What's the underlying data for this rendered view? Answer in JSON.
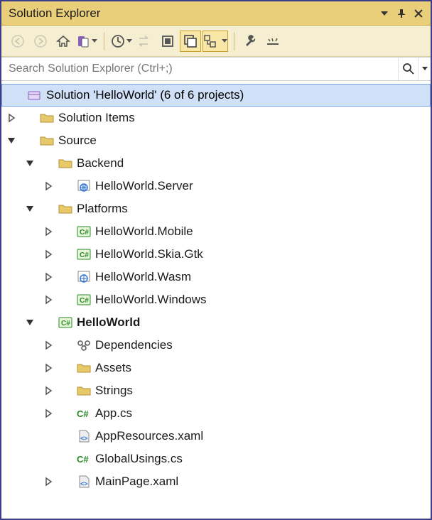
{
  "window": {
    "title": "Solution Explorer"
  },
  "toolbar": {
    "back": "Back",
    "forward": "Forward",
    "home": "Home",
    "switch_views": "Switch Views",
    "pending_filter": "Filter",
    "sync": "Sync with Active Document",
    "refresh": "Refresh",
    "collapse_all": "Collapse All",
    "show_all": "Show All Files",
    "view_class": "View Class Diagram",
    "properties": "Properties",
    "preview": "Preview Selected Items"
  },
  "search": {
    "placeholder": "Search Solution Explorer (Ctrl+;)"
  },
  "tree": {
    "solution": "Solution 'HelloWorld' (6 of 6 projects)",
    "solution_items": "Solution Items",
    "source": "Source",
    "backend": "Backend",
    "server": "HelloWorld.Server",
    "platforms": "Platforms",
    "mobile": "HelloWorld.Mobile",
    "skia": "HelloWorld.Skia.Gtk",
    "wasm": "HelloWorld.Wasm",
    "windows": "HelloWorld.Windows",
    "app": "HelloWorld",
    "deps": "Dependencies",
    "assets": "Assets",
    "strings": "Strings",
    "appcs": "App.cs",
    "appres": "AppResources.xaml",
    "globals": "GlobalUsings.cs",
    "mainpage": "MainPage.xaml"
  }
}
